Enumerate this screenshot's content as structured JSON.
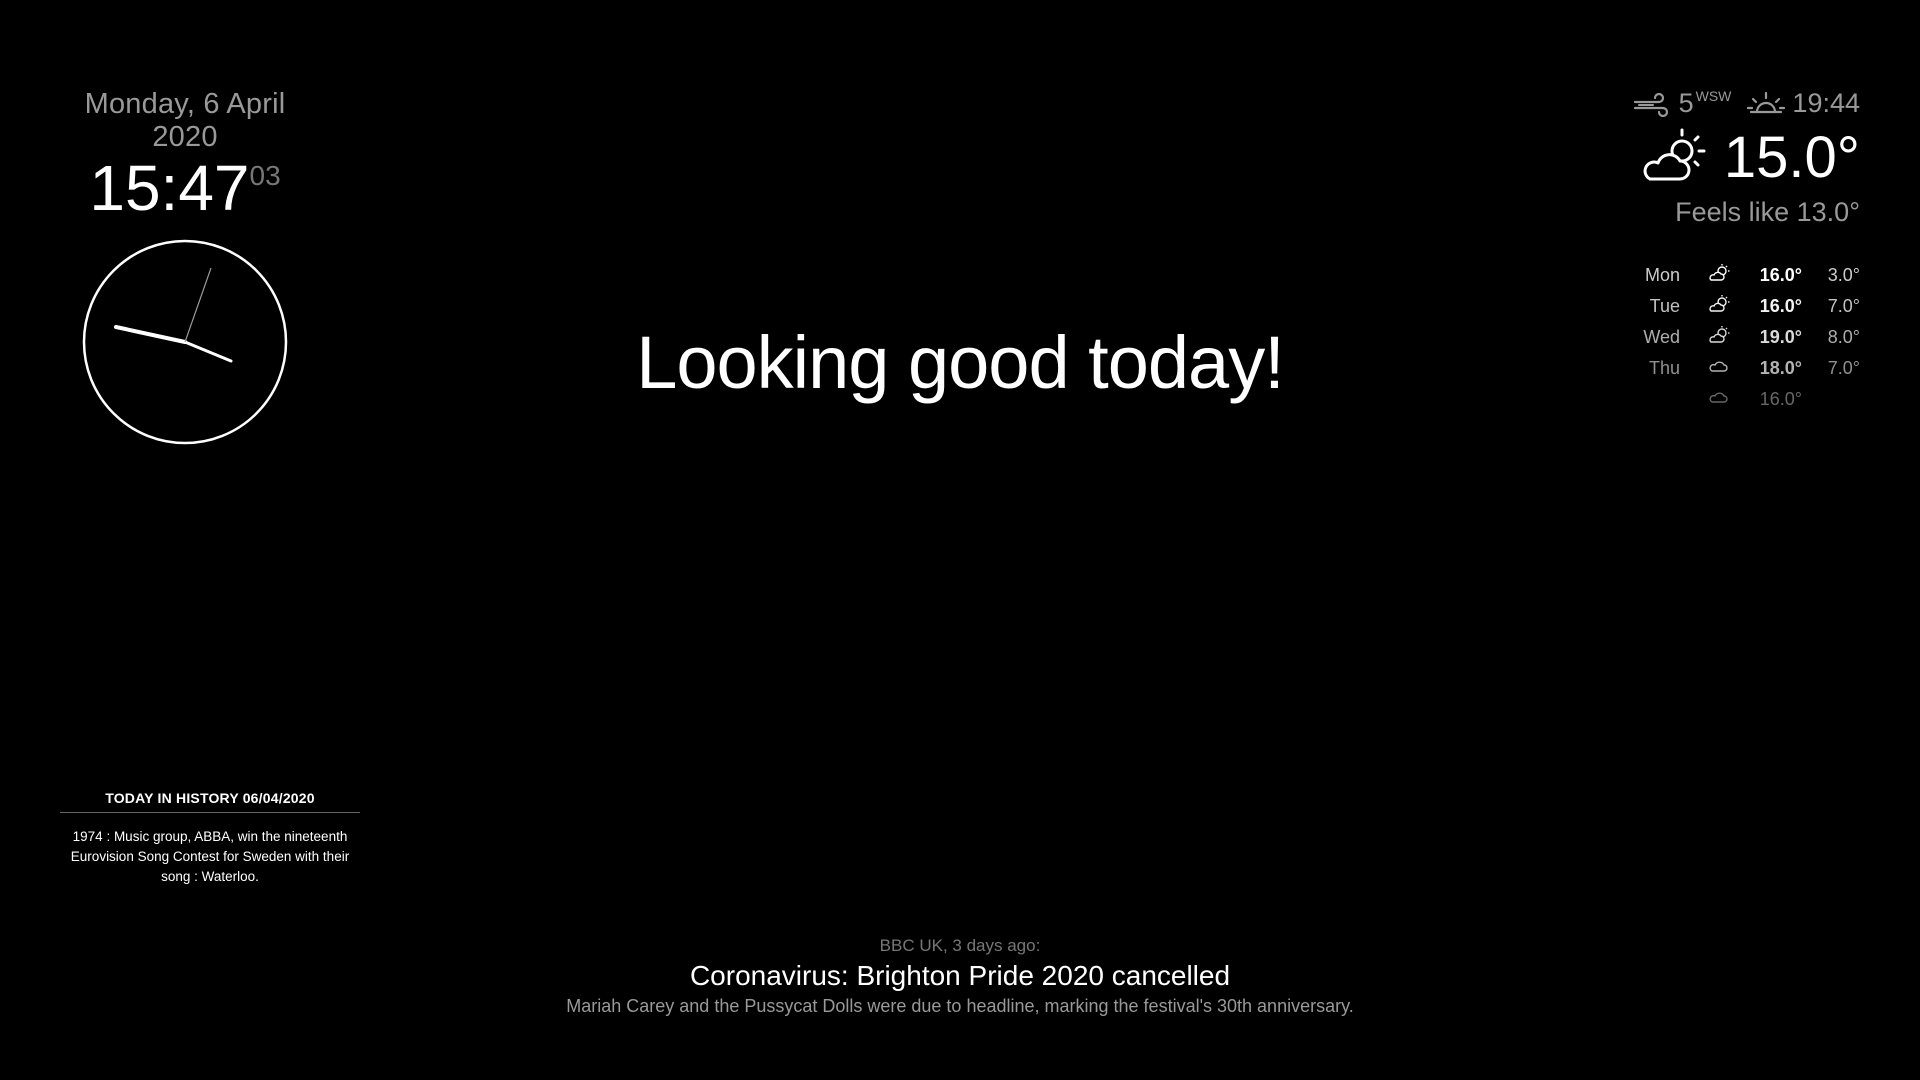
{
  "clock": {
    "date": "Monday, 6 April 2020",
    "hours_minutes": "15:47",
    "seconds": "03"
  },
  "weather": {
    "wind_speed": "5",
    "wind_direction": "WSW",
    "sunset_time": "19:44",
    "current_temp": "15.0°",
    "feels_like": "Feels like 13.0°",
    "icons": {
      "wind": "wind-icon",
      "sunset": "sunset-icon",
      "current": "partly-cloudy-day-icon"
    },
    "forecast": [
      {
        "day": "Mon",
        "icon": "partly-cloudy-icon",
        "max": "16.0°",
        "min": "3.0°"
      },
      {
        "day": "Tue",
        "icon": "partly-cloudy-icon",
        "max": "16.0°",
        "min": "7.0°"
      },
      {
        "day": "Wed",
        "icon": "partly-cloudy-icon",
        "max": "19.0°",
        "min": "8.0°"
      },
      {
        "day": "Thu",
        "icon": "cloud-icon",
        "max": "18.0°",
        "min": "7.0°"
      },
      {
        "day": "",
        "icon": "cloud-icon",
        "max": "16.0°",
        "min": ""
      }
    ]
  },
  "compliment": "Looking good today!",
  "history": {
    "header": "TODAY IN HISTORY 06/04/2020",
    "text": "1974 : Music group, ABBA, win the nineteenth Eurovision Song Contest for Sweden with their song : Waterloo."
  },
  "news": {
    "source": "BBC UK, 3 days ago:",
    "headline": "Coronavirus: Brighton Pride 2020 cancelled",
    "description": "Mariah Carey and the Pussycat Dolls were due to headline, marking the festival's 30th anniversary."
  }
}
